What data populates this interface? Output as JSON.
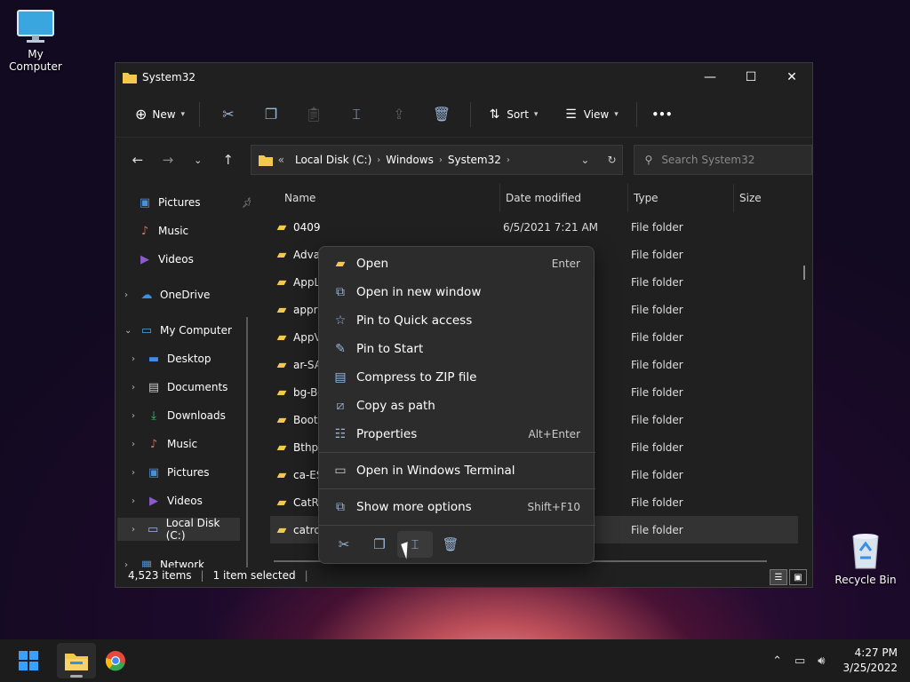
{
  "desktop": {
    "icons": [
      {
        "label": "My Computer",
        "icon": "monitor-icon"
      },
      {
        "label": "Recycle Bin",
        "icon": "recycle-bin-icon"
      }
    ]
  },
  "window": {
    "title": "System32",
    "toolbar": {
      "new_label": "New",
      "sort_label": "Sort",
      "view_label": "View",
      "more_label": "•••"
    },
    "address": {
      "overflow": "«",
      "crumbs": [
        "Local Disk (C:)",
        "Windows",
        "System32"
      ],
      "search_placeholder": "Search System32"
    },
    "sidebar": {
      "items": [
        {
          "label": "Pictures",
          "icon": "pictures-icon",
          "color": "#4a90d9"
        },
        {
          "label": "Music",
          "icon": "music-icon",
          "color": "#e06a5a"
        },
        {
          "label": "Videos",
          "icon": "videos-icon",
          "color": "#8a5cc8"
        },
        {
          "label": "OneDrive",
          "icon": "onedrive-icon",
          "color": "#3a8ee6"
        },
        {
          "label": "My Computer",
          "icon": "monitor-icon",
          "color": "#4aa6d9"
        },
        {
          "label": "Desktop",
          "icon": "desktop-icon",
          "color": "#3a8ee6"
        },
        {
          "label": "Documents",
          "icon": "documents-icon",
          "color": "#c8c8c8"
        },
        {
          "label": "Downloads",
          "icon": "downloads-icon",
          "color": "#3ac27a"
        },
        {
          "label": "Music",
          "icon": "music-icon",
          "color": "#e06a5a"
        },
        {
          "label": "Pictures",
          "icon": "pictures-icon",
          "color": "#4a90d9"
        },
        {
          "label": "Videos",
          "icon": "videos-icon",
          "color": "#8a5cc8"
        },
        {
          "label": "Local Disk (C:)",
          "icon": "drive-icon",
          "color": "#9ab6d8"
        },
        {
          "label": "Network",
          "icon": "network-icon",
          "color": "#4a90d9"
        }
      ]
    },
    "columns": [
      "Name",
      "Date modified",
      "Type",
      "Size"
    ],
    "files": [
      {
        "name": "0409",
        "date": "6/5/2021 7:21 AM",
        "type": "File folder"
      },
      {
        "name": "Advan",
        "date": "",
        "type": "File folder"
      },
      {
        "name": "AppL",
        "date": "",
        "type": "File folder"
      },
      {
        "name": "appra",
        "date": "",
        "type": "File folder"
      },
      {
        "name": "AppV",
        "date": "",
        "type": "File folder"
      },
      {
        "name": "ar-SA",
        "date": "",
        "type": "File folder"
      },
      {
        "name": "bg-BG",
        "date": "",
        "type": "File folder"
      },
      {
        "name": "Boot",
        "date": "",
        "type": "File folder"
      },
      {
        "name": "Bthpr",
        "date": "",
        "type": "File folder"
      },
      {
        "name": "ca-ES",
        "date": "",
        "type": "File folder"
      },
      {
        "name": "CatRo",
        "date": "",
        "type": "File folder"
      },
      {
        "name": "catroo",
        "date": "",
        "type": "File folder"
      }
    ],
    "status": {
      "items": "4,523 items",
      "selected": "1 item selected"
    }
  },
  "context_menu": {
    "items": [
      {
        "label": "Open",
        "shortcut": "Enter",
        "icon": "folder-icon"
      },
      {
        "label": "Open in new window",
        "shortcut": "",
        "icon": "open-new-window-icon"
      },
      {
        "label": "Pin to Quick access",
        "shortcut": "",
        "icon": "star-icon"
      },
      {
        "label": "Pin to Start",
        "shortcut": "",
        "icon": "pin-icon"
      },
      {
        "label": "Compress to ZIP file",
        "shortcut": "",
        "icon": "zip-icon"
      },
      {
        "label": "Copy as path",
        "shortcut": "",
        "icon": "copy-path-icon"
      },
      {
        "label": "Properties",
        "shortcut": "Alt+Enter",
        "icon": "properties-icon"
      },
      {
        "label": "Open in Windows Terminal",
        "shortcut": "",
        "icon": "terminal-icon"
      },
      {
        "label": "Show more options",
        "shortcut": "Shift+F10",
        "icon": "more-options-icon"
      }
    ],
    "actions": [
      "cut-icon",
      "copy-icon",
      "rename-icon",
      "delete-icon"
    ]
  },
  "taskbar": {
    "clock_time": "4:27 PM",
    "clock_date": "3/25/2022"
  }
}
